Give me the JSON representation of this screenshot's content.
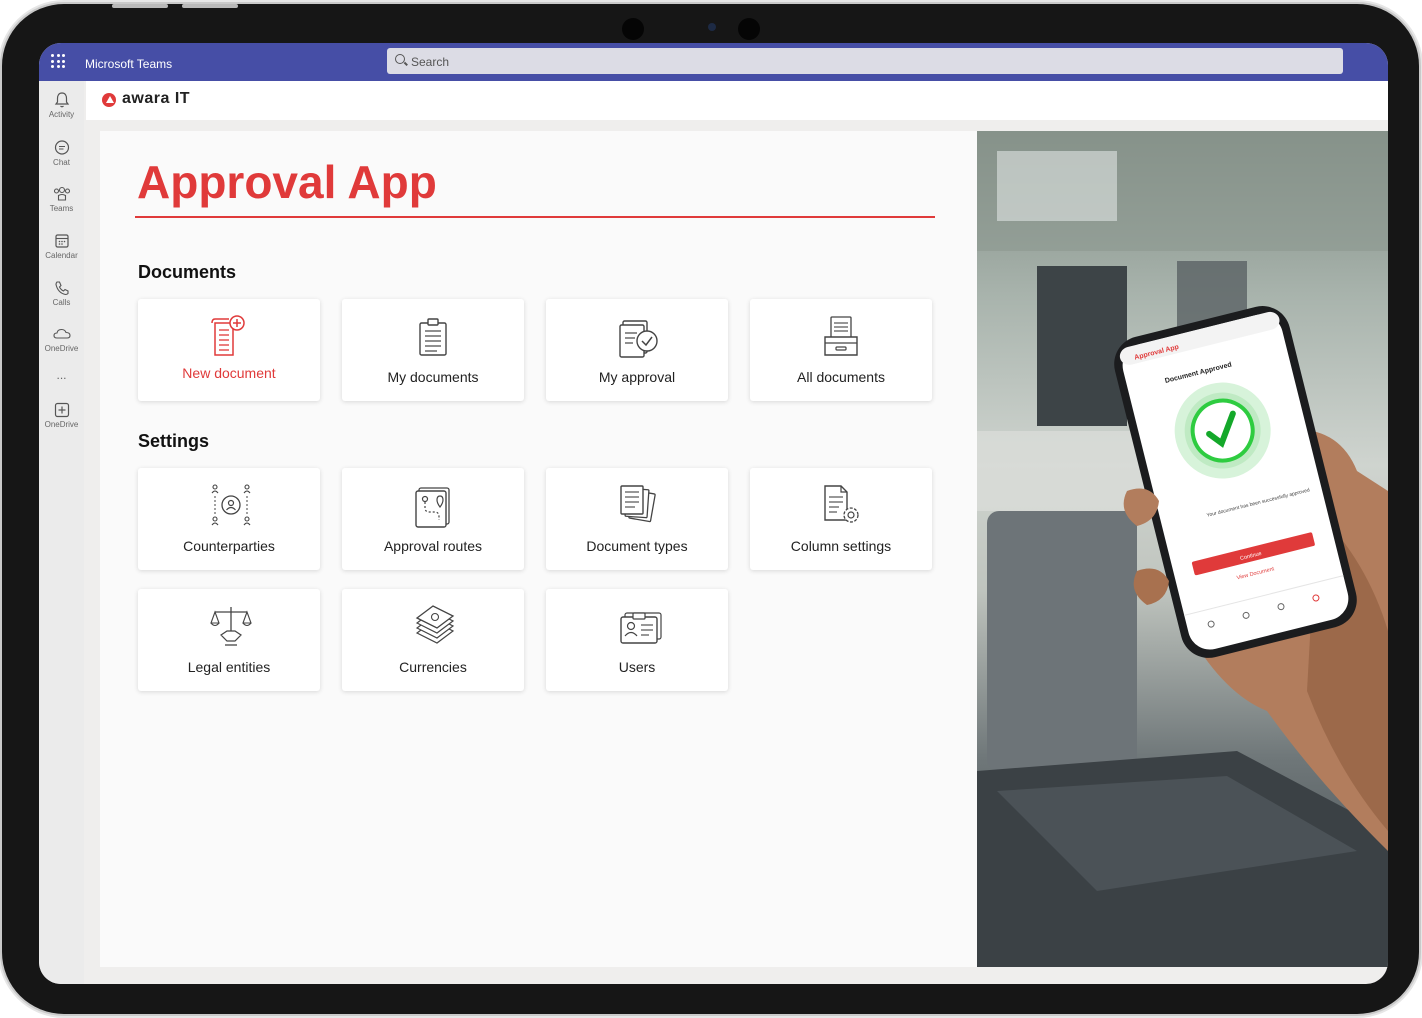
{
  "teams": {
    "app_name": "Microsoft Teams",
    "search_placeholder": "Search"
  },
  "rail": [
    {
      "label": "Activity",
      "icon": "bell-icon"
    },
    {
      "label": "Chat",
      "icon": "chat-icon"
    },
    {
      "label": "Teams",
      "icon": "teams-icon"
    },
    {
      "label": "Calendar",
      "icon": "calendar-icon"
    },
    {
      "label": "Calls",
      "icon": "phone-icon"
    },
    {
      "label": "OneDrive",
      "icon": "cloud-icon"
    },
    {
      "label": "OneDrive",
      "icon": "plus-square-icon"
    }
  ],
  "rail_more": "...",
  "brand": {
    "logo_text": "awara IT",
    "accent": "#e03a3a"
  },
  "app": {
    "title": "Approval App"
  },
  "documents": {
    "heading": "Documents",
    "tiles": [
      {
        "label": "New document",
        "icon": "new-document-icon"
      },
      {
        "label": "My documents",
        "icon": "documents-icon"
      },
      {
        "label": "My approval",
        "icon": "approval-icon"
      },
      {
        "label": "All documents",
        "icon": "archive-icon"
      }
    ]
  },
  "settings": {
    "heading": "Settings",
    "tiles": [
      {
        "label": "Counterparties",
        "icon": "counterparties-icon"
      },
      {
        "label": "Approval routes",
        "icon": "route-icon"
      },
      {
        "label": "Document types",
        "icon": "document-types-icon"
      },
      {
        "label": "Column settings",
        "icon": "column-settings-icon"
      },
      {
        "label": "Legal entities",
        "icon": "scales-icon"
      },
      {
        "label": "Currencies",
        "icon": "money-icon"
      },
      {
        "label": "Users",
        "icon": "users-icon"
      }
    ]
  },
  "phone": {
    "app_title": "Approval App",
    "status": "Document Approved",
    "message": "Your document has been successfully approved",
    "primary_button": "Continue",
    "secondary_button": "View Document"
  }
}
